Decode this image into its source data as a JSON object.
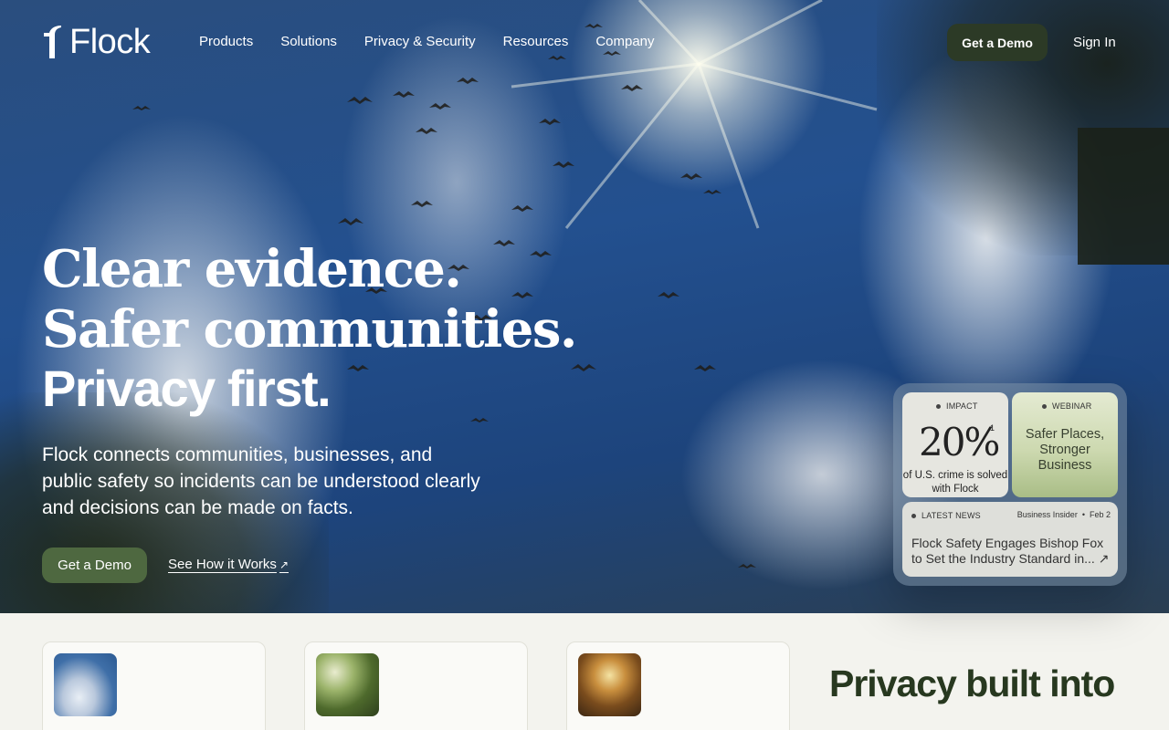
{
  "nav": {
    "logo_text": "Flock",
    "links": [
      "Products",
      "Solutions",
      "Privacy & Security",
      "Resources",
      "Company"
    ],
    "demo_label": "Get a Demo",
    "signin_label": "Sign In"
  },
  "hero": {
    "headline_1": "Clear evidence.",
    "headline_2": "Safer communities.",
    "headline_3": "Privacy first.",
    "subhead": "Flock connects communities, businesses, and public safety so incidents can be understood clearly and decisions can be made on facts.",
    "cta_demo": "Get a Demo",
    "cta_how": "See How it Works"
  },
  "panel": {
    "impact": {
      "tag": "IMPACT",
      "number": "20%",
      "superscript": "1",
      "text": "of U.S. crime is solved with Flock"
    },
    "webinar": {
      "tag": "WEBINAR",
      "text": "Safer Places, Stronger Business"
    },
    "news": {
      "tag": "LATEST NEWS",
      "source": "Business Insider",
      "date": "Feb 2",
      "title": "Flock Safety Engages Bishop Fox to Set the Industry Standard in..."
    }
  },
  "lower": {
    "privacy_title": "Privacy built into"
  },
  "colors": {
    "brand_dark": "#2c3a26",
    "brand_green": "#4e6840",
    "heading_green": "#27381f"
  },
  "icons": [
    "flock-logo-icon",
    "arrow-up-right-icon"
  ]
}
